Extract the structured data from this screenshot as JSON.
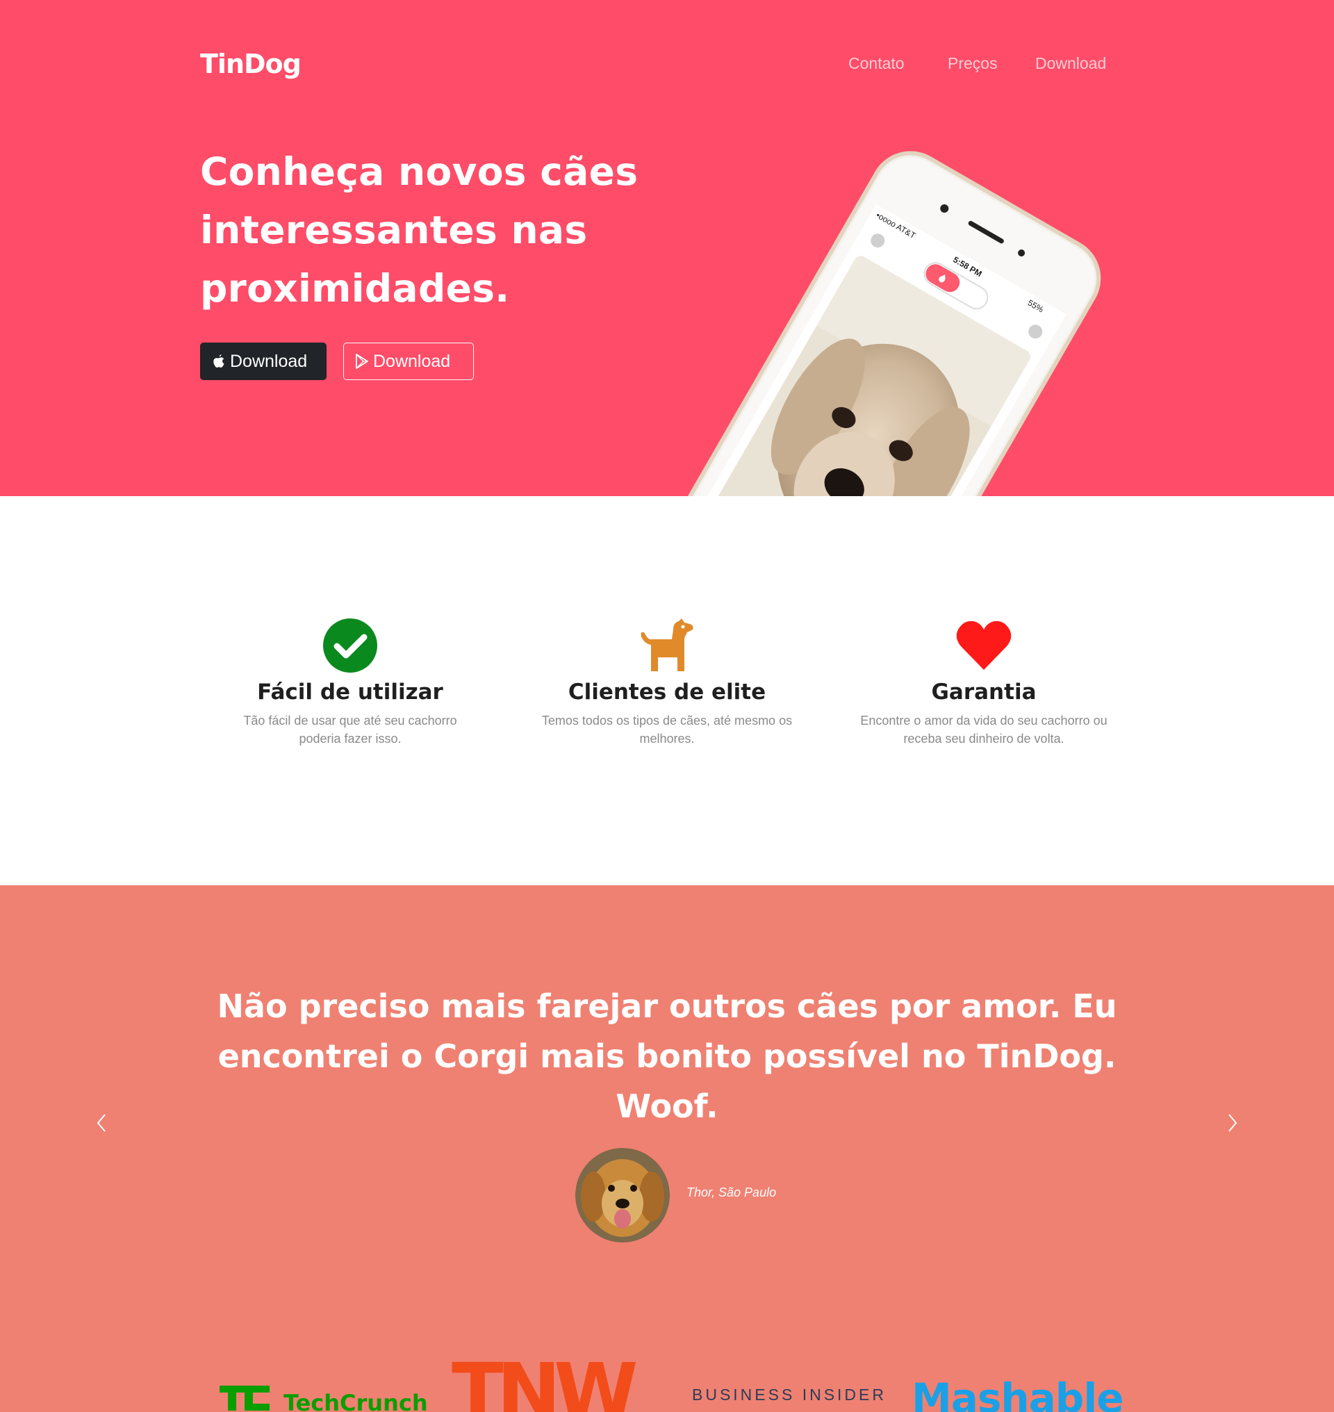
{
  "nav": {
    "brand": "TinDog",
    "links": [
      "Contato",
      "Preços",
      "Download"
    ]
  },
  "hero": {
    "title": "Conheça novos cães interessantes nas proximidades.",
    "buttons": {
      "apple_label": "Download",
      "play_label": "Download"
    },
    "phone": {
      "carrier": "•oooo AT&T",
      "time": "5:58 PM",
      "battery": "55%"
    }
  },
  "features": [
    {
      "icon": "check-circle-icon",
      "title": "Fácil de utilizar",
      "text": "Tão fácil de usar que até seu cachorro poderia fazer isso."
    },
    {
      "icon": "dog-icon",
      "title": "Clientes de elite",
      "text": "Temos todos os tipos de cães, até mesmo os melhores."
    },
    {
      "icon": "heart-icon",
      "title": "Garantia",
      "text": "Encontre o amor da vida do seu cachorro ou receba seu dinheiro de volta."
    }
  ],
  "testimonial": {
    "quote": "Não preciso mais farejar outros cães por amor. Eu encontrei o Corgi mais bonito possível no TinDog. Woof.",
    "author": "Thor, São Paulo"
  },
  "press": {
    "techcrunch": "TechCrunch",
    "tnw": "TNW",
    "business_insider": "BUSINESS INSIDER",
    "mashable": "Mashable"
  },
  "colors": {
    "hero_bg": "#ff4c68",
    "testimonial_bg": "#ef8172",
    "check_green": "#0a8a1e",
    "dog_orange": "#e08a2a",
    "heart_red": "#ff1a1a"
  }
}
